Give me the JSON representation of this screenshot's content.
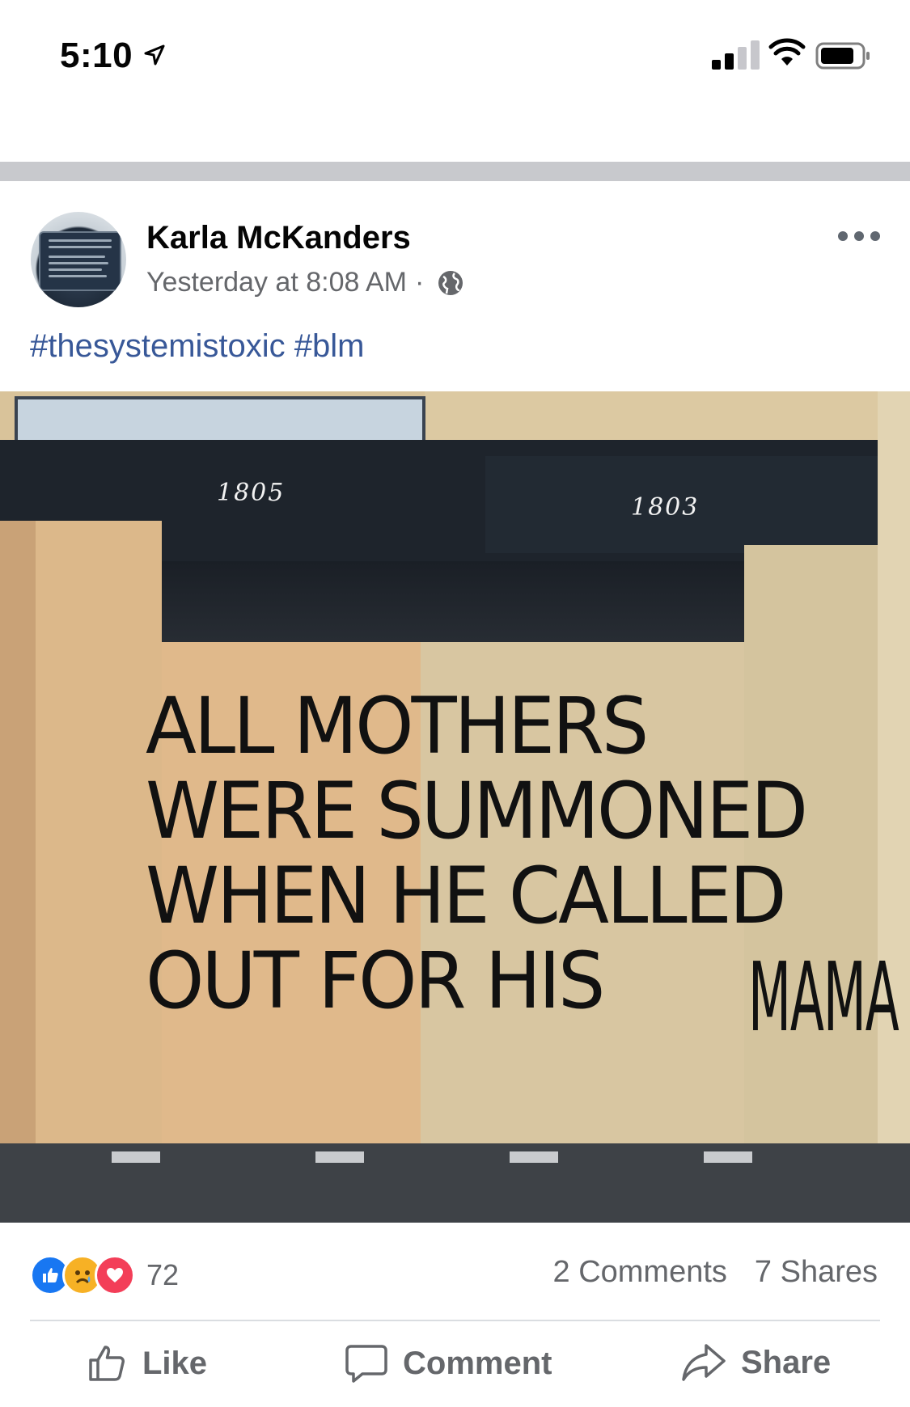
{
  "status_bar": {
    "time": "5:10"
  },
  "post": {
    "author": "Karla McKanders",
    "timestamp": "Yesterday at 8:08 AM",
    "separator": "·",
    "hashtags": [
      "#thesystemistoxic",
      "#blm"
    ],
    "photo": {
      "address_left": "1805",
      "address_right": "1803",
      "graffiti_lines": [
        "ALL MOTHERS",
        "WERE SUMMONED",
        "WHEN HE CALLED",
        "OUT FOR HIS"
      ],
      "graffiti_side": "MAMA"
    },
    "reactions": {
      "types": [
        "like-icon",
        "sad-icon",
        "love-icon"
      ],
      "count": "72"
    },
    "comments": "2 Comments",
    "shares": "7 Shares"
  },
  "actions": {
    "like": "Like",
    "comment": "Comment",
    "share": "Share"
  },
  "colors": {
    "link": "#385898",
    "meta": "#65676b",
    "like_blue": "#1877f2",
    "love_red": "#f33e58",
    "sad_yellow": "#f7b125"
  }
}
